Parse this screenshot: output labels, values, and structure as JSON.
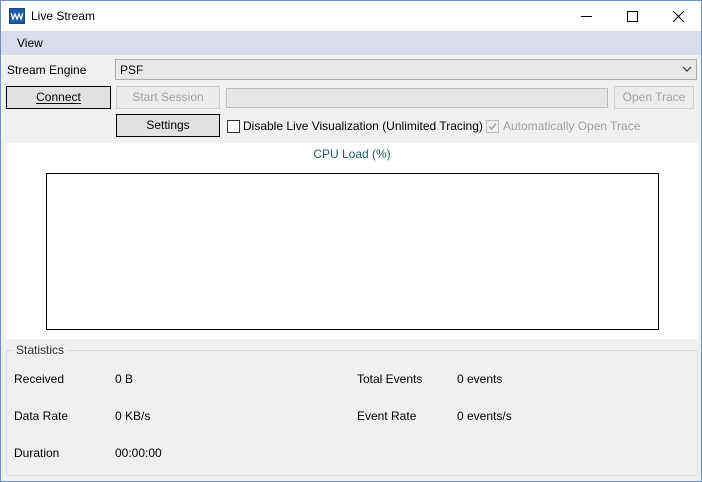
{
  "window": {
    "title": "Live Stream"
  },
  "menu": {
    "items": [
      {
        "label": "View"
      }
    ]
  },
  "controls": {
    "stream_engine_label": "Stream Engine",
    "stream_engine_value": "PSF",
    "connect_button": "Connect",
    "start_session_button": "Start Session",
    "open_trace_button": "Open Trace",
    "settings_button": "Settings",
    "disable_live_vis_label": "Disable Live Visualization (Unlimited Tracing)",
    "disable_live_vis_checked": false,
    "auto_open_trace_label": "Automatically Open Trace",
    "auto_open_trace_checked": true,
    "session_progress": 0
  },
  "chart": {
    "title": "CPU Load (%)"
  },
  "chart_data": {
    "type": "line",
    "title": "CPU Load (%)",
    "series": [],
    "grid": false
  },
  "statistics": {
    "title": "Statistics",
    "received_label": "Received",
    "received_value": "0 B",
    "data_rate_label": "Data Rate",
    "data_rate_value": "0 KB/s",
    "duration_label": "Duration",
    "duration_value": "00:00:00",
    "total_events_label": "Total Events",
    "total_events_value": "0 events",
    "event_rate_label": "Event Rate",
    "event_rate_value": "0 events/s"
  }
}
